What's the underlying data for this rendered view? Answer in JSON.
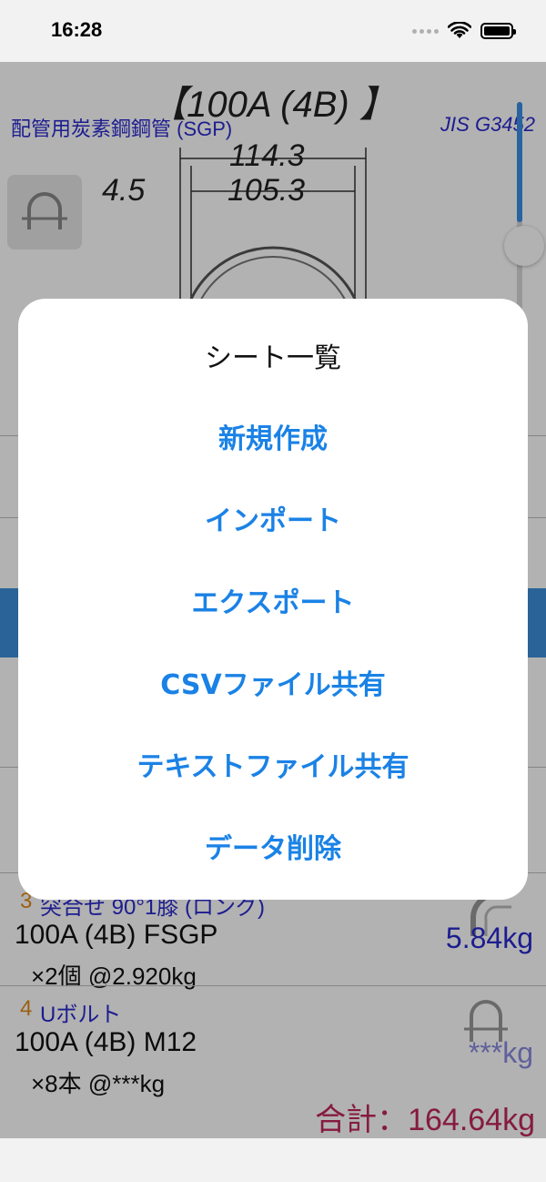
{
  "status_bar": {
    "time": "16:28"
  },
  "pipe": {
    "title": "【100A (4B) 】",
    "name": "配管用炭素鋼鋼管 (SGP)",
    "standard": "JIS G3452",
    "outer_diameter": "114.3",
    "inner_diameter": "105.3",
    "thickness": "4.5"
  },
  "rows": [
    {
      "index": "3",
      "category": "突合せ 90°1膝 (ロング)",
      "spec": "100A (4B) FSGP",
      "qty": "×2個 @2.920kg",
      "weight": "5.84kg",
      "icon": "elbow-icon"
    },
    {
      "index": "4",
      "category": "Uボルト",
      "spec": "100A (4B) M12",
      "qty": "×8本 @***kg",
      "weight": "***kg",
      "icon": "u-bolt-icon"
    }
  ],
  "total": "合計：164.64kg",
  "sheet": {
    "title": "シート一覧",
    "items": [
      {
        "label": "新規作成"
      },
      {
        "label": "インポート"
      },
      {
        "label": "エクスポート"
      },
      {
        "label": "CSVファイル共有"
      },
      {
        "label": "テキストファイル共有"
      },
      {
        "label": "データ削除"
      }
    ]
  },
  "colors": {
    "accent": "#1a82e6",
    "link_text": "#2a2acf",
    "index_orange": "#e08a1a",
    "total_red": "#c0285a"
  }
}
